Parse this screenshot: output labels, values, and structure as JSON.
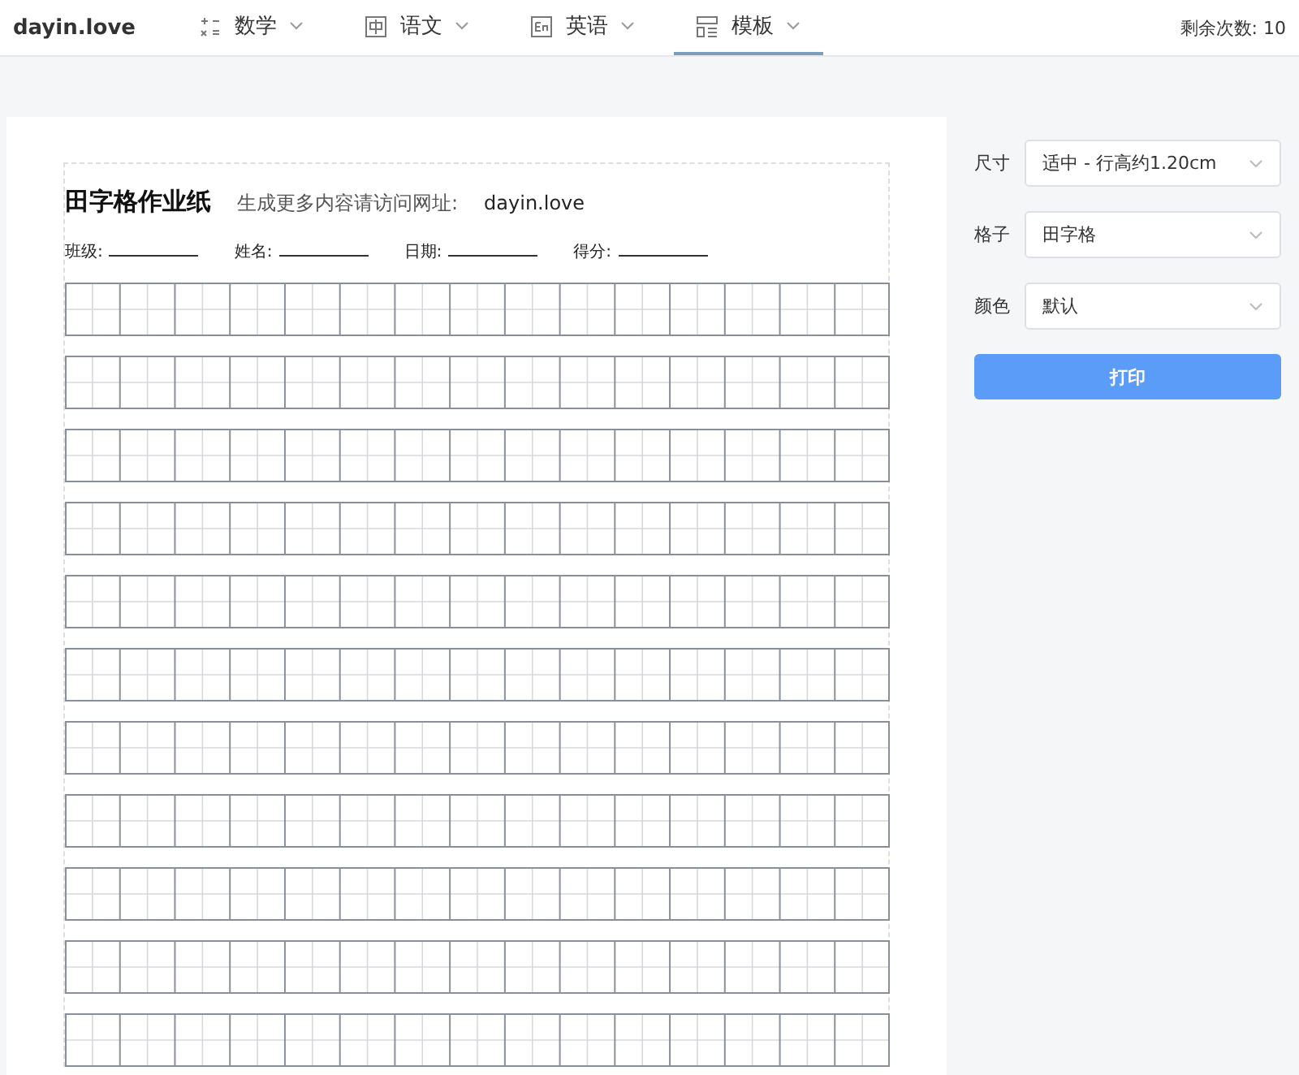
{
  "brand": "dayin.love",
  "nav": [
    {
      "label": "数学",
      "selected": false
    },
    {
      "label": "语文",
      "selected": false
    },
    {
      "label": "英语",
      "selected": false
    },
    {
      "label": "模板",
      "selected": true
    }
  ],
  "remaining": {
    "label": "剩余次数:",
    "value": "10"
  },
  "paper": {
    "title": "田字格作业纸",
    "note": "生成更多内容请访问网址:",
    "site": "dayin.love",
    "fields": [
      {
        "label": "班级:"
      },
      {
        "label": "姓名:"
      },
      {
        "label": "日期:"
      },
      {
        "label": "得分:"
      }
    ]
  },
  "settings": [
    {
      "label": "尺寸",
      "value": "适中 - 行高约1.20cm"
    },
    {
      "label": "格子",
      "value": "田字格"
    },
    {
      "label": "颜色",
      "value": "默认"
    }
  ],
  "print_button": "打印"
}
